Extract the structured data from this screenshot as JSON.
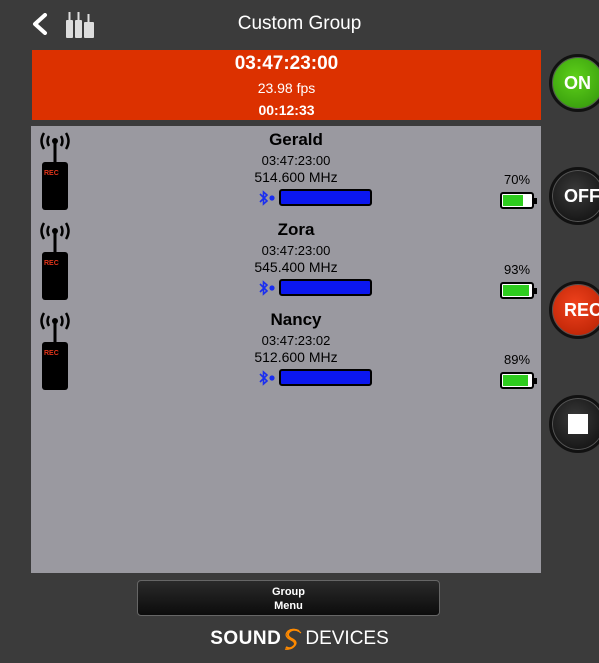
{
  "header": {
    "title": "Custom Group",
    "back_icon": "chevron-left-icon",
    "group_icon": "transmitter-group-icon"
  },
  "timecode": {
    "main": "03:47:23:00",
    "fps": "23.98 fps",
    "elapsed": "00:12:33",
    "background": "#dc3100"
  },
  "devices": [
    {
      "name": "Gerald",
      "timecode": "03:47:23:00",
      "frequency": "514.600 MHz",
      "battery_pct": "70%",
      "battery_level": 0.7,
      "rf_level": 1.0,
      "icon_label": "REC"
    },
    {
      "name": "Zora",
      "timecode": "03:47:23:00",
      "frequency": "545.400 MHz",
      "battery_pct": "93%",
      "battery_level": 0.93,
      "rf_level": 1.0,
      "icon_label": "REC"
    },
    {
      "name": "Nancy",
      "timecode": "03:47:23:02",
      "frequency": "512.600 MHz",
      "battery_pct": "89%",
      "battery_level": 0.89,
      "rf_level": 1.0,
      "icon_label": "REC"
    }
  ],
  "side_buttons": {
    "on": "ON",
    "off": "OFF",
    "rec": "REC",
    "stop_icon": "stop-icon"
  },
  "group_menu": {
    "line1": "Group",
    "line2": "Menu"
  },
  "brand": {
    "sound": "SOUND",
    "devices": "DEVICES",
    "logo_color": "#ff8a00"
  },
  "colors": {
    "background": "#3b3b3b",
    "panel": "#9a99a0",
    "rf_bar": "#0b17f0",
    "battery_fill": "#2ecc1e",
    "on_button": "#4cbd14",
    "rec_button": "#e0351a"
  }
}
